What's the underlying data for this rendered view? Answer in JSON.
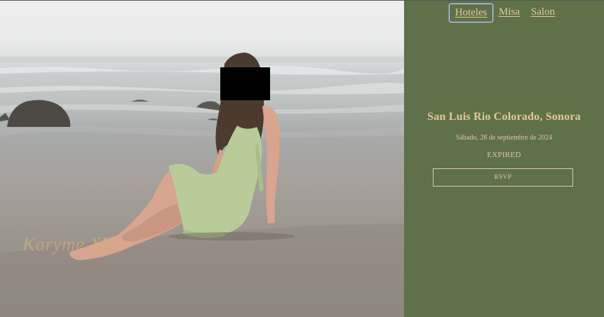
{
  "hero": {
    "photo_label": "Karyme XV",
    "censor_color": "#000000"
  },
  "nav": {
    "items": [
      {
        "label": "Hoteles",
        "active": true
      },
      {
        "label": "Misa",
        "active": false
      },
      {
        "label": "Salon",
        "active": false
      }
    ]
  },
  "event": {
    "location": "San Luis Rio Colorado, Sonora",
    "date": "Sábado, 28 de septiembre de 2024",
    "status": "EXPIRED",
    "rsvp_label": "RSVP"
  },
  "colors": {
    "panel_green": "#5e7149",
    "accent_gold": "#e4c89d",
    "dress_green": "#b7cc98"
  }
}
